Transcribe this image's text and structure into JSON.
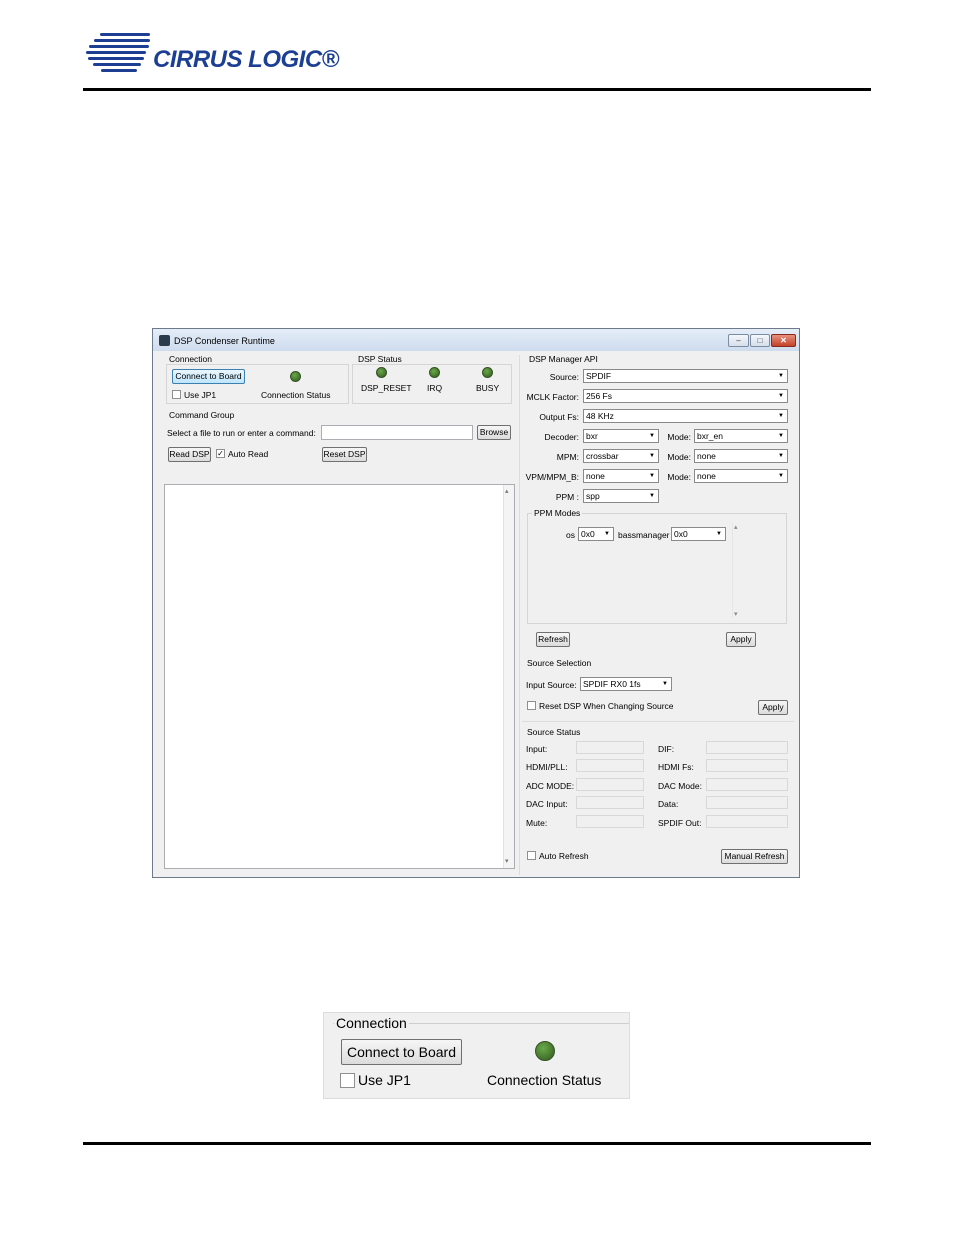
{
  "header": {
    "logo_text": "CIRRUS LOGIC®"
  },
  "window": {
    "title": "DSP Condenser Runtime",
    "controls": {
      "minimize": "–",
      "maximize": "□",
      "close": "✕"
    }
  },
  "connection": {
    "group_label": "Connection",
    "connect_button": "Connect to Board",
    "use_jp1_label": "Use JP1",
    "status_label": "Connection Status"
  },
  "dsp_status": {
    "group_label": "DSP Status",
    "indicators": [
      "DSP_RESET",
      "IRQ",
      "BUSY"
    ]
  },
  "command_group": {
    "group_label": "Command Group",
    "prompt": "Select a file to run or enter a command:",
    "command_value": "",
    "browse_button": "Browse",
    "read_dsp_button": "Read DSP",
    "auto_read_label": "Auto Read",
    "auto_read_mark": "✓",
    "reset_dsp_button": "Reset DSP",
    "scroll_up": "▴",
    "scroll_down": "▾"
  },
  "dsp_manager": {
    "group_label": "DSP Manager API",
    "source_label": "Source:",
    "source_value": "SPDIF",
    "mclk_label": "MCLK Factor:",
    "mclk_value": "256 Fs",
    "output_fs_label": "Output Fs:",
    "output_fs_value": "48 KHz",
    "decoder_label": "Decoder:",
    "decoder_value": "bxr",
    "decoder_mode_label": "Mode:",
    "decoder_mode_value": "bxr_en",
    "mpm_label": "MPM:",
    "mpm_value": "crossbar",
    "mpm_mode_label": "Mode:",
    "mpm_mode_value": "none",
    "vpm_label": "VPM/MPM_B:",
    "vpm_value": "none",
    "vpm_mode_label": "Mode:",
    "vpm_mode_value": "none",
    "ppm_label": "PPM :",
    "ppm_value": "spp",
    "arrow": "▼"
  },
  "ppm_modes": {
    "group_label": "PPM Modes",
    "os_label": "os",
    "os_value": "0x0",
    "bass_label": "bassmanager",
    "bass_value": "0x0",
    "refresh_button": "Refresh",
    "apply_button": "Apply",
    "scroll_up": "▴",
    "scroll_down": "▾"
  },
  "source_selection": {
    "group_label": "Source Selection",
    "input_source_label": "Input Source:",
    "input_source_value": "SPDIF RX0 1fs",
    "reset_label": "Reset DSP When Changing Source",
    "apply_button": "Apply"
  },
  "source_status": {
    "group_label": "Source Status",
    "left_fields": [
      "Input:",
      "HDMI/PLL:",
      "ADC MODE:",
      "DAC Input:",
      "Mute:"
    ],
    "right_fields": [
      "DIF:",
      "HDMI Fs:",
      "DAC Mode:",
      "Data:",
      "SPDIF Out:"
    ],
    "auto_refresh_label": "Auto Refresh",
    "manual_refresh_button": "Manual Refresh"
  },
  "zoom": {
    "group_label": "Connection",
    "connect_button": "Connect to Board",
    "use_jp1_label": "Use JP1",
    "status_label": "Connection Status"
  },
  "colors": {
    "logo_blue": "#1c3f94",
    "led_green": "#3f6f27",
    "titlebar": "#dbe5f3",
    "window_bg": "#f0f0f0"
  }
}
